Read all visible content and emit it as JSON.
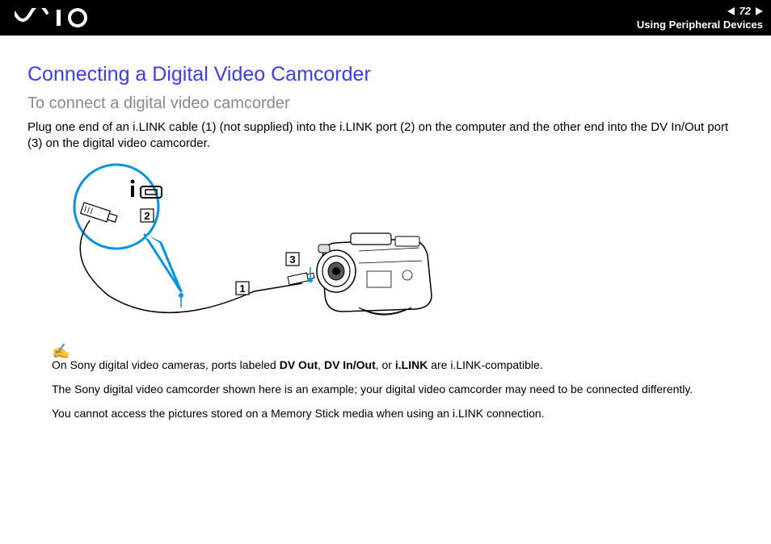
{
  "header": {
    "page_number": "72",
    "section": "Using Peripheral Devices",
    "logo_alt": "VAIO"
  },
  "content": {
    "title": "Connecting a Digital Video Camcorder",
    "subtitle": "To connect a digital video camcorder",
    "body": "Plug one end of an i.LINK cable (1) (not supplied) into the i.LINK port (2) on the computer and the other end into the DV In/Out port (3) on the digital video camcorder."
  },
  "diagram": {
    "labels": {
      "cable": "1",
      "port": "2",
      "dv_port": "3"
    }
  },
  "notes": {
    "line1_pre": "On Sony digital video cameras, ports labeled ",
    "dvout": "DV Out",
    "sep1": ", ",
    "dvinout": "DV In/Out",
    "sep2": ", or ",
    "ilink": "i.LINK",
    "line1_post": " are i.LINK-compatible.",
    "line2": "The Sony digital video camcorder shown here is an example; your digital video camcorder may need to be connected differently.",
    "line3": "You cannot access the pictures stored on a Memory Stick media when using an i.LINK connection."
  }
}
